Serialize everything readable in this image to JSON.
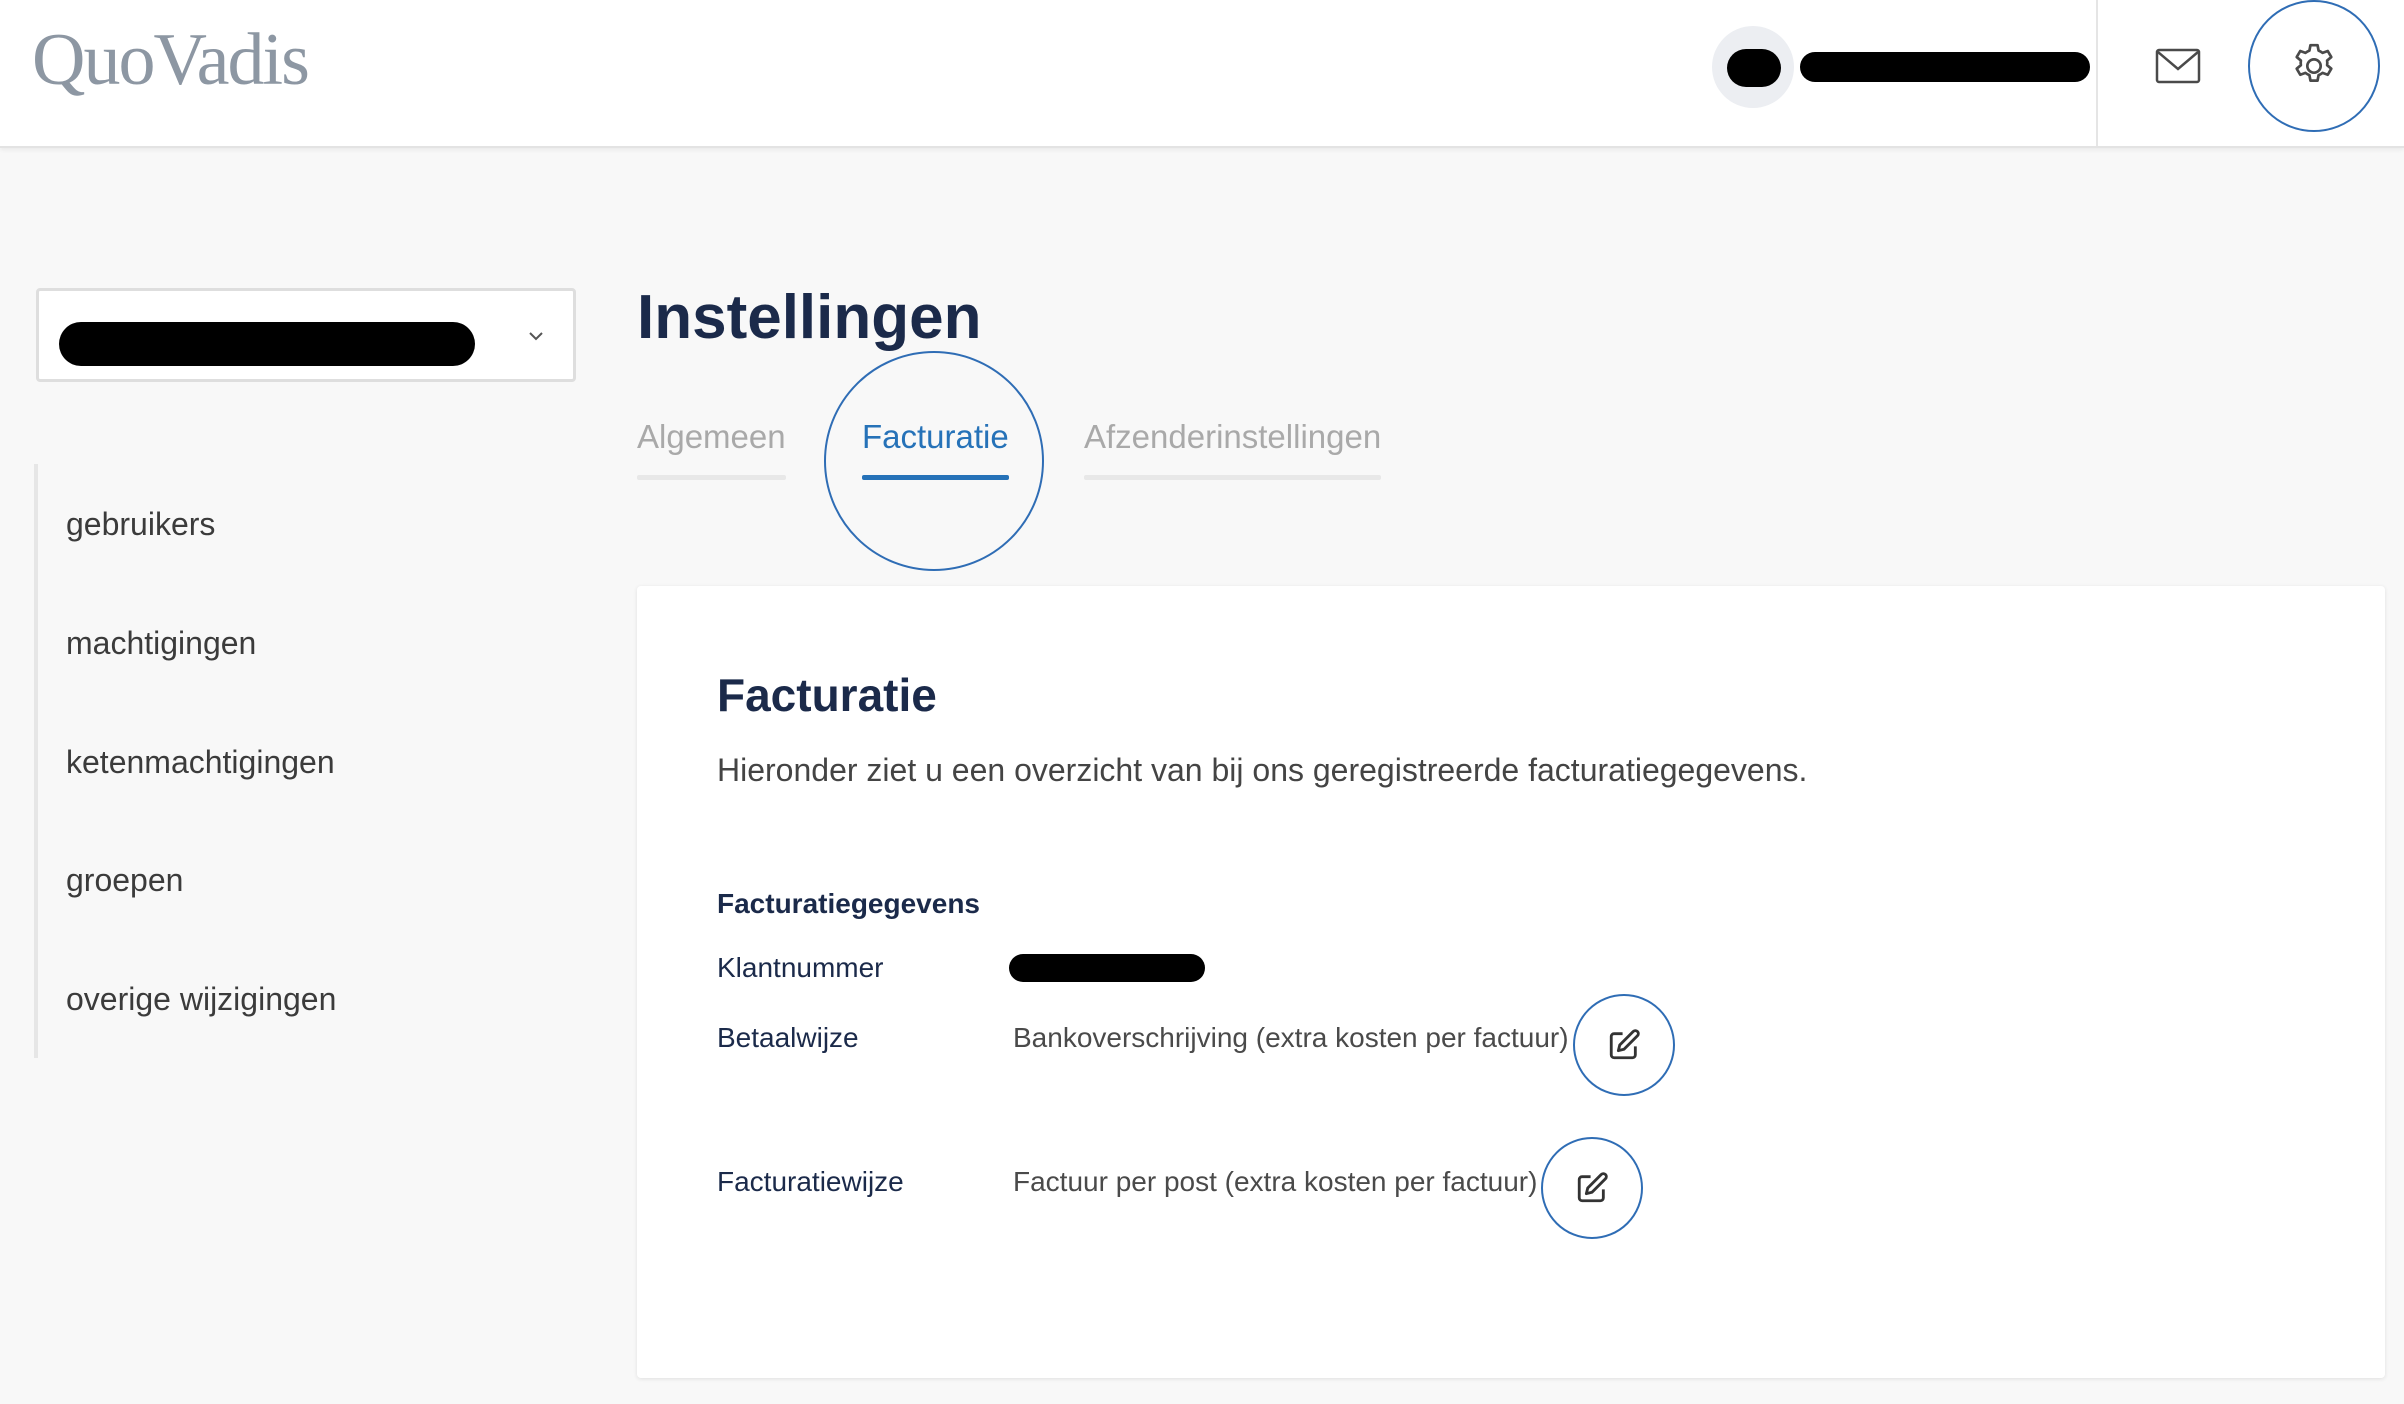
{
  "header": {
    "logo_text": "QuoVadis",
    "icons": {
      "mail": "mail-icon",
      "settings": "gear-icon"
    },
    "accent_color": "#2f6db5"
  },
  "sidebar": {
    "items": [
      {
        "label": "gebruikers"
      },
      {
        "label": "machtigingen"
      },
      {
        "label": "ketenmachtigingen"
      },
      {
        "label": "groepen"
      },
      {
        "label": "overige wijzigingen"
      }
    ]
  },
  "main": {
    "title": "Instellingen",
    "tabs": [
      {
        "label": "Algemeen",
        "active": false
      },
      {
        "label": "Facturatie",
        "active": true
      },
      {
        "label": "Afzenderinstellingen",
        "active": false
      }
    ],
    "active_tab_color": "#2672b8"
  },
  "card": {
    "title": "Facturatie",
    "description": "Hieronder ziet u een overzicht van bij ons geregistreerde facturatiegegevens.",
    "section_heading": "Facturatiegegevens",
    "rows": [
      {
        "label": "Klantnummer",
        "value": ""
      },
      {
        "label": "Betaalwijze",
        "value": "Bankoverschrijving (extra kosten per factuur)",
        "edit_icon": "edit-icon"
      },
      {
        "label": "Facturatiewijze",
        "value": "Factuur per post (extra kosten per factuur)",
        "edit_icon": "edit-icon"
      }
    ]
  }
}
